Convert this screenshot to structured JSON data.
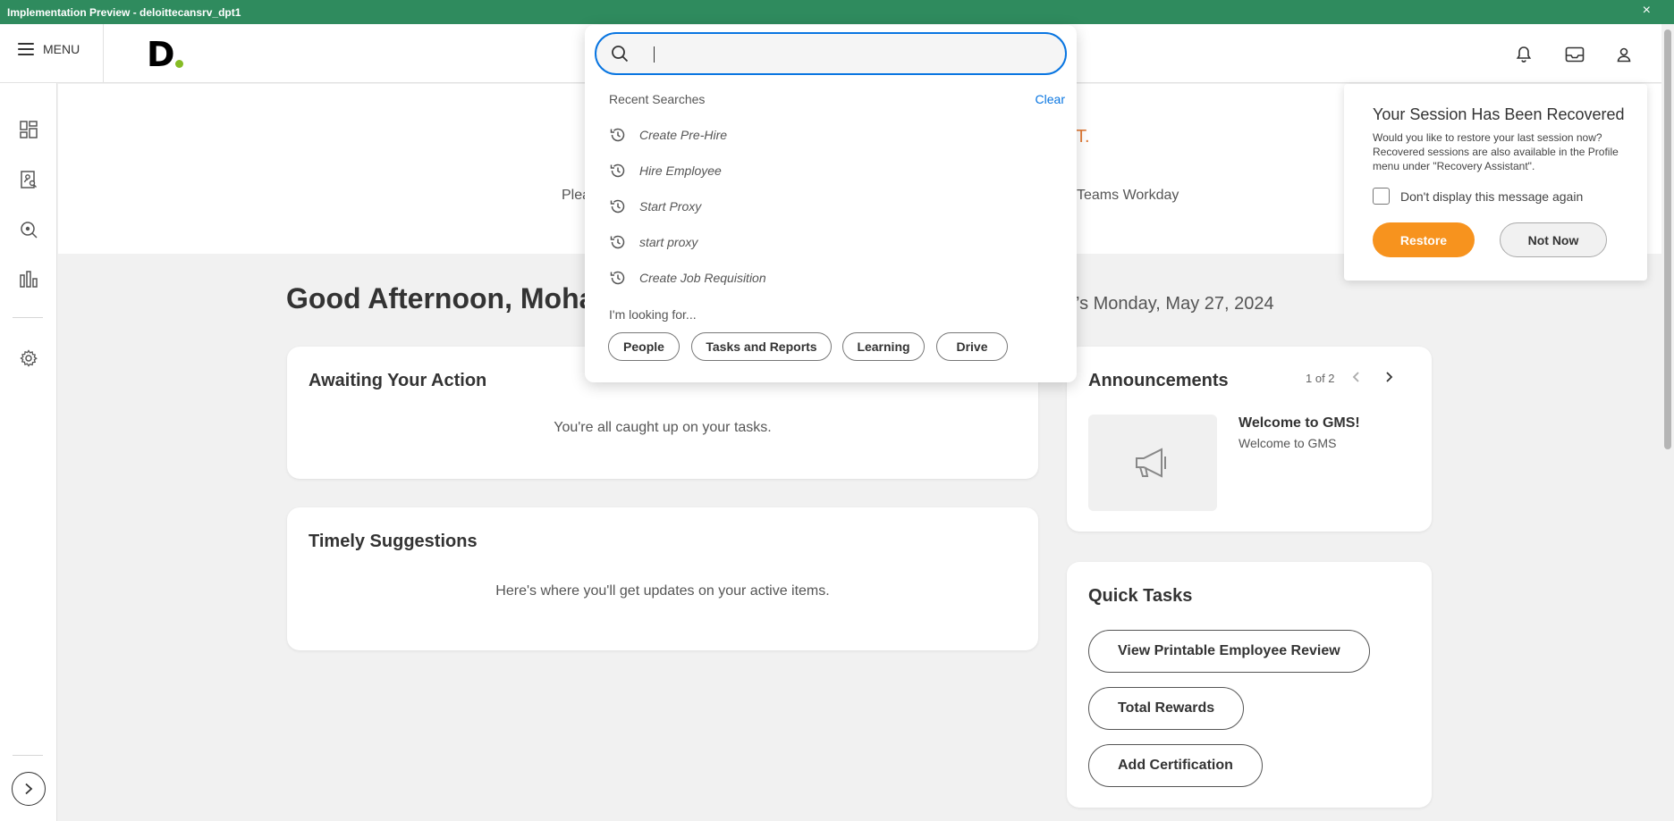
{
  "window": {
    "title": "Implementation Preview - deloittecansrv_dpt1",
    "close_icon": "close-icon"
  },
  "header": {
    "menu_label": "MENU",
    "logo_text": "D",
    "brand_color": "#86bc25",
    "accent_color": "#0875e1"
  },
  "banner": {
    "left_text": "Plea",
    "right_text": "Teams Workday",
    "mark": "T."
  },
  "greeting": {
    "text": "Good Afternoon, Mohar",
    "date": "’s Monday, May 27, 2024"
  },
  "awaiting": {
    "title": "Awaiting Your Action",
    "body": "You're all caught up on your tasks.",
    "more": "..."
  },
  "suggestions": {
    "title": "Timely Suggestions",
    "body": "Here's where you'll get updates on your active items."
  },
  "announcements": {
    "title": "Announcements",
    "pager": "1 of 2",
    "item_title": "Welcome to GMS!",
    "item_body": "Welcome to GMS"
  },
  "quick_tasks": {
    "title": "Quick Tasks",
    "buttons": [
      "View Printable Employee Review",
      "Total Rewards",
      "Add Certification"
    ]
  },
  "search": {
    "placeholder": "",
    "recent_header": "Recent Searches",
    "clear_label": "Clear",
    "recent": [
      "Create Pre-Hire",
      "Hire Employee",
      "Start Proxy",
      "start proxy",
      "Create Job Requisition"
    ],
    "looking_label": "I'm looking for...",
    "chips": [
      "People",
      "Tasks and Reports",
      "Learning",
      "Drive"
    ]
  },
  "session": {
    "title": "Your Session Has Been Recovered",
    "message": "Would you like to restore your last session now? Recovered sessions are also available in the Profile menu under \"Recovery Assistant\".",
    "checkbox_label": "Don't display this message again",
    "restore_label": "Restore",
    "notnow_label": "Not Now",
    "restore_color": "#f7931e"
  }
}
